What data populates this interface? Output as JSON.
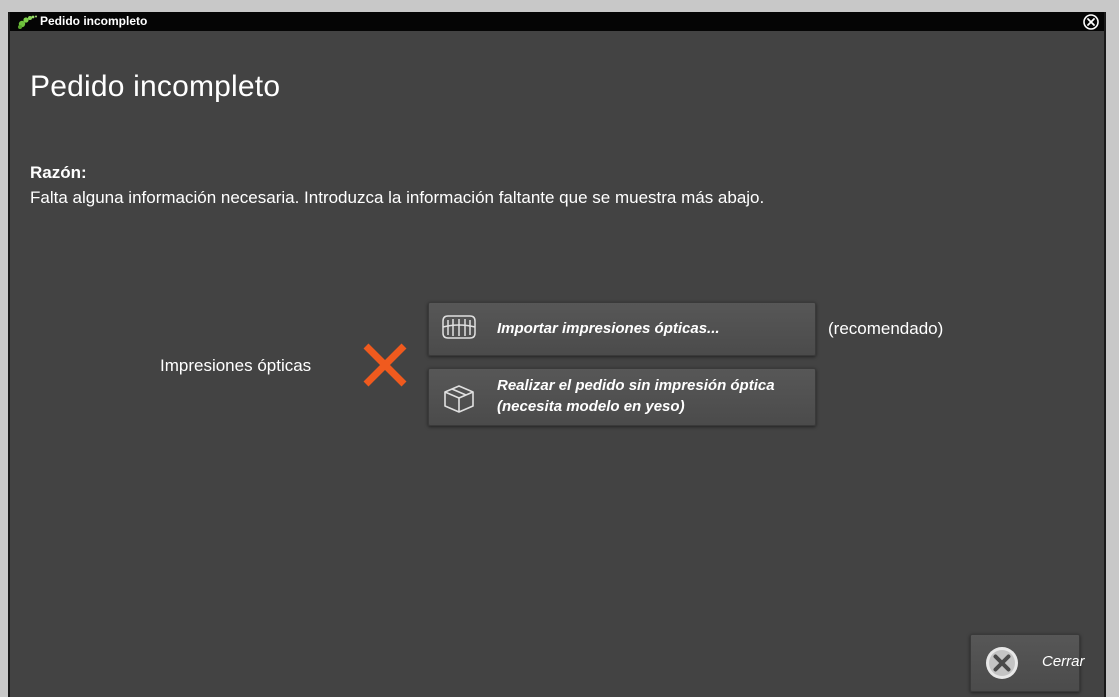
{
  "window": {
    "title": "Pedido incompleto",
    "close_icon": "close-circle-icon",
    "app_icon": "app-logo-icon"
  },
  "main": {
    "heading": "Pedido incompleto",
    "reason_label": "Razón:",
    "reason_text": "Falta alguna información necesaria. Introduzca la información faltante que se muestra más abajo."
  },
  "requirements": [
    {
      "label": "Impresiones ópticas",
      "status": "missing",
      "status_icon": "red-x-icon",
      "status_color": "#f05a1e",
      "actions": [
        {
          "label": "Importar impresiones ópticas...",
          "icon": "optical-impressions-icon",
          "note": "(recomendado)"
        },
        {
          "label": "Realizar el pedido sin impresión óptica\n(necesita modelo en yeso)",
          "icon": "box-icon"
        }
      ]
    }
  ],
  "footer": {
    "close_label": "Cerrar",
    "close_icon": "cancel-icon"
  },
  "colors": {
    "background": "#434343",
    "titlebar": "#050505",
    "text": "#ffffff",
    "accent_error": "#f05a1e"
  }
}
